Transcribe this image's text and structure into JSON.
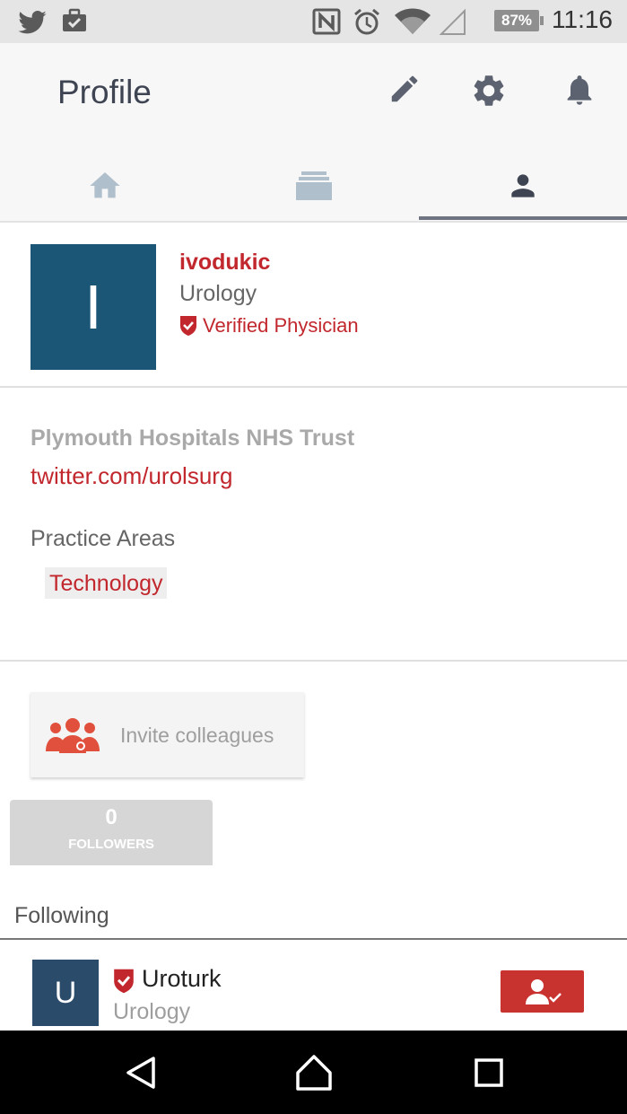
{
  "status_bar": {
    "time": "11:16",
    "battery": "87%",
    "icons": [
      "twitter-icon",
      "briefcase-check-icon",
      "nfc-icon",
      "alarm-icon",
      "wifi-icon",
      "cell-signal-icon",
      "battery-icon"
    ]
  },
  "header": {
    "title": "Profile",
    "actions": [
      "edit-icon",
      "settings-icon",
      "notifications-icon"
    ]
  },
  "tabs": [
    {
      "icon": "home-icon",
      "selected": false
    },
    {
      "icon": "cards-icon",
      "selected": false
    },
    {
      "icon": "person-icon",
      "selected": true
    }
  ],
  "profile": {
    "avatar_letter": "I",
    "username": "ivodukic",
    "specialty": "Urology",
    "verified_label": "Verified Physician",
    "organization": "Plymouth Hospitals NHS Trust",
    "link": "twitter.com/urolsurg",
    "practice_heading": "Practice Areas",
    "practice_areas": [
      "Technology"
    ]
  },
  "invite": {
    "label": "Invite colleagues"
  },
  "followers": {
    "count": "0",
    "label": "FOLLOWERS"
  },
  "following": {
    "heading": "Following",
    "items": [
      {
        "avatar_letter": "U",
        "name": "Uroturk",
        "specialty": "Urology"
      }
    ]
  },
  "colors": {
    "accent_red": "#c1272d",
    "avatar_blue": "#1b5676",
    "tab_indicator": "#6e7482"
  }
}
